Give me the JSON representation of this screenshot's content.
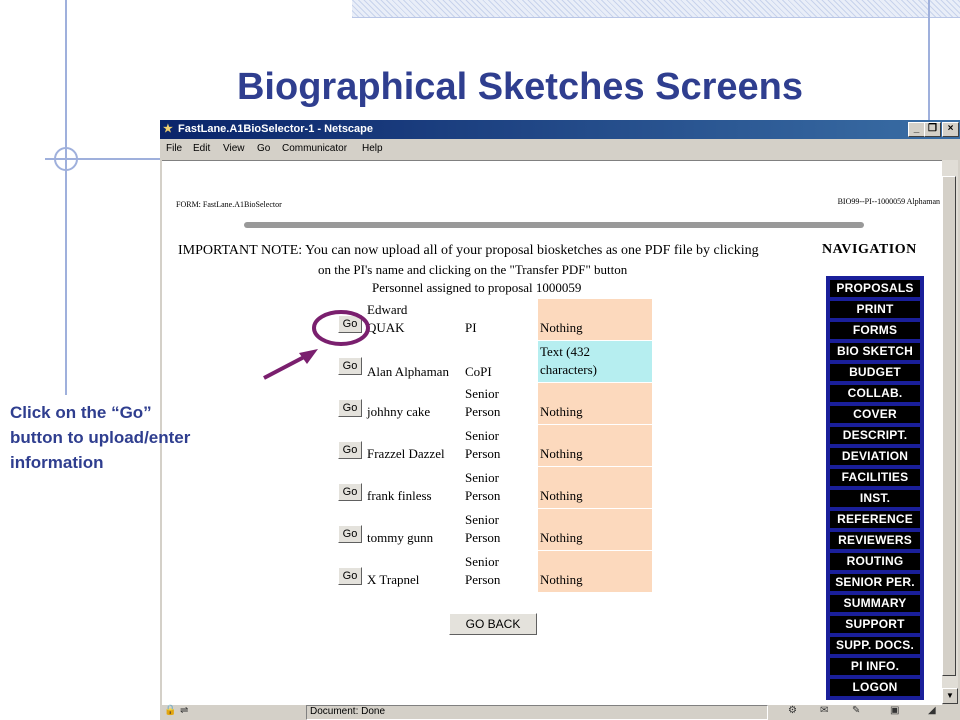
{
  "slide": {
    "title": "Biographical Sketches Screens",
    "callout": [
      "Click on the “Go”",
      "button to upload/enter",
      "information"
    ]
  },
  "window": {
    "title": "FastLane.A1BioSelector-1 - Netscape",
    "controls": {
      "minimize": "_",
      "restore": "❐",
      "close": "×"
    },
    "menu": [
      "File",
      "Edit",
      "View",
      "Go",
      "Communicator",
      "Help"
    ],
    "status": "Document: Done"
  },
  "page": {
    "form_label": "FORM: FastLane.A1BioSelector",
    "bio_label": "BIO99--PI--1000059 Alphaman",
    "note_line1": "IMPORTANT NOTE: You can now upload all of your proposal biosketches as one PDF file by clicking",
    "note_line2": "on the PI's name and clicking on the \"Transfer PDF\" button",
    "personnel_header": "Personnel assigned to proposal 1000059",
    "go_label": "Go",
    "go_back": "GO BACK",
    "navigation_heading": "NAVIGATION",
    "personnel": [
      {
        "name": [
          "Edward",
          "QUAK"
        ],
        "role": [
          "PI"
        ],
        "status": [
          "Nothing"
        ]
      },
      {
        "name": [
          "Alan Alphaman"
        ],
        "role": [
          "CoPI"
        ],
        "status": [
          "Text (432",
          "characters)"
        ]
      },
      {
        "name": [
          "johhny cake"
        ],
        "role": [
          "Senior",
          "Person"
        ],
        "status": [
          "Nothing"
        ]
      },
      {
        "name": [
          "Frazzel Dazzel"
        ],
        "role": [
          "Senior",
          "Person"
        ],
        "status": [
          "Nothing"
        ]
      },
      {
        "name": [
          "frank finless"
        ],
        "role": [
          "Senior",
          "Person"
        ],
        "status": [
          "Nothing"
        ]
      },
      {
        "name": [
          "tommy gunn"
        ],
        "role": [
          "Senior",
          "Person"
        ],
        "status": [
          "Nothing"
        ]
      },
      {
        "name": [
          "X Trapnel"
        ],
        "role": [
          "Senior",
          "Person"
        ],
        "status": [
          "Nothing"
        ]
      }
    ],
    "nav_items": [
      "PROPOSALS",
      "PRINT",
      "FORMS",
      "BIO SKETCH",
      "BUDGET",
      "COLLAB.",
      "COVER",
      "DESCRIPT.",
      "DEVIATION",
      "FACILITIES",
      "INST.",
      "REFERENCE",
      "REVIEWERS",
      "ROUTING",
      "SENIOR PER.",
      "SUMMARY",
      "SUPPORT",
      "SUPP. DOCS.",
      "PI INFO.",
      "LOGON"
    ]
  },
  "colors": {
    "title": "#2f3e8f",
    "nav_bg": "#1a1f9a",
    "status_nothing": "#fcd9bd",
    "status_text": "#b6eef0",
    "highlight": "#7a1f6e"
  }
}
